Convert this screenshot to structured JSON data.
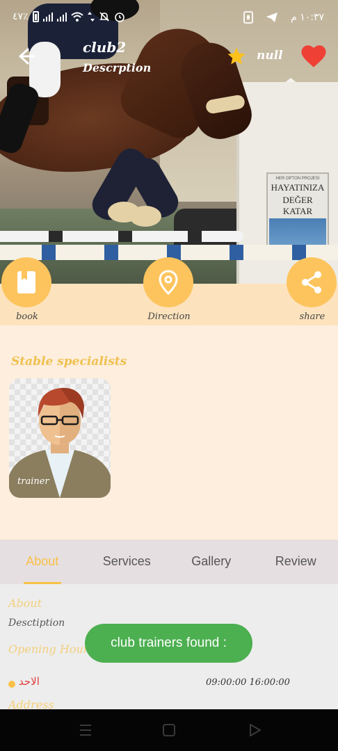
{
  "status_bar": {
    "battery_text": "٤٧٪",
    "time_text": "١٠:٣٧ م"
  },
  "header": {
    "title": "club2",
    "description": "Descrption",
    "rating": "null"
  },
  "booth_sign": {
    "small_text": "HER OPTON PROJESİ",
    "main_text_1": "HAYATINIZA",
    "main_text_2": "DEĞER KATAR"
  },
  "actions": [
    {
      "label": "book",
      "icon": "book-icon"
    },
    {
      "label": "Direction",
      "icon": "location-pin-icon"
    },
    {
      "label": "share",
      "icon": "share-icon"
    }
  ],
  "specialists": {
    "title": "Stable specialists",
    "cards": [
      {
        "label": "trainer",
        "icon": "trainer-avatar-icon"
      }
    ]
  },
  "tabs": [
    {
      "label": "About",
      "active": true
    },
    {
      "label": "Services",
      "active": false
    },
    {
      "label": "Gallery",
      "active": false
    },
    {
      "label": "Review",
      "active": false
    }
  ],
  "about": {
    "about_heading": "About",
    "about_text": "Desctiption",
    "hours_heading": "Opening Hours",
    "hours": [
      {
        "day": "الاحد",
        "time": "09:00:00 16:00:00"
      }
    ],
    "address_heading": "Address"
  },
  "toast": "club trainers found :",
  "colors": {
    "accent": "#fdc45e",
    "heart": "#ef4035",
    "toast": "#4caf50",
    "tab_active": "#f8c146",
    "day_text": "#e23b3b"
  }
}
